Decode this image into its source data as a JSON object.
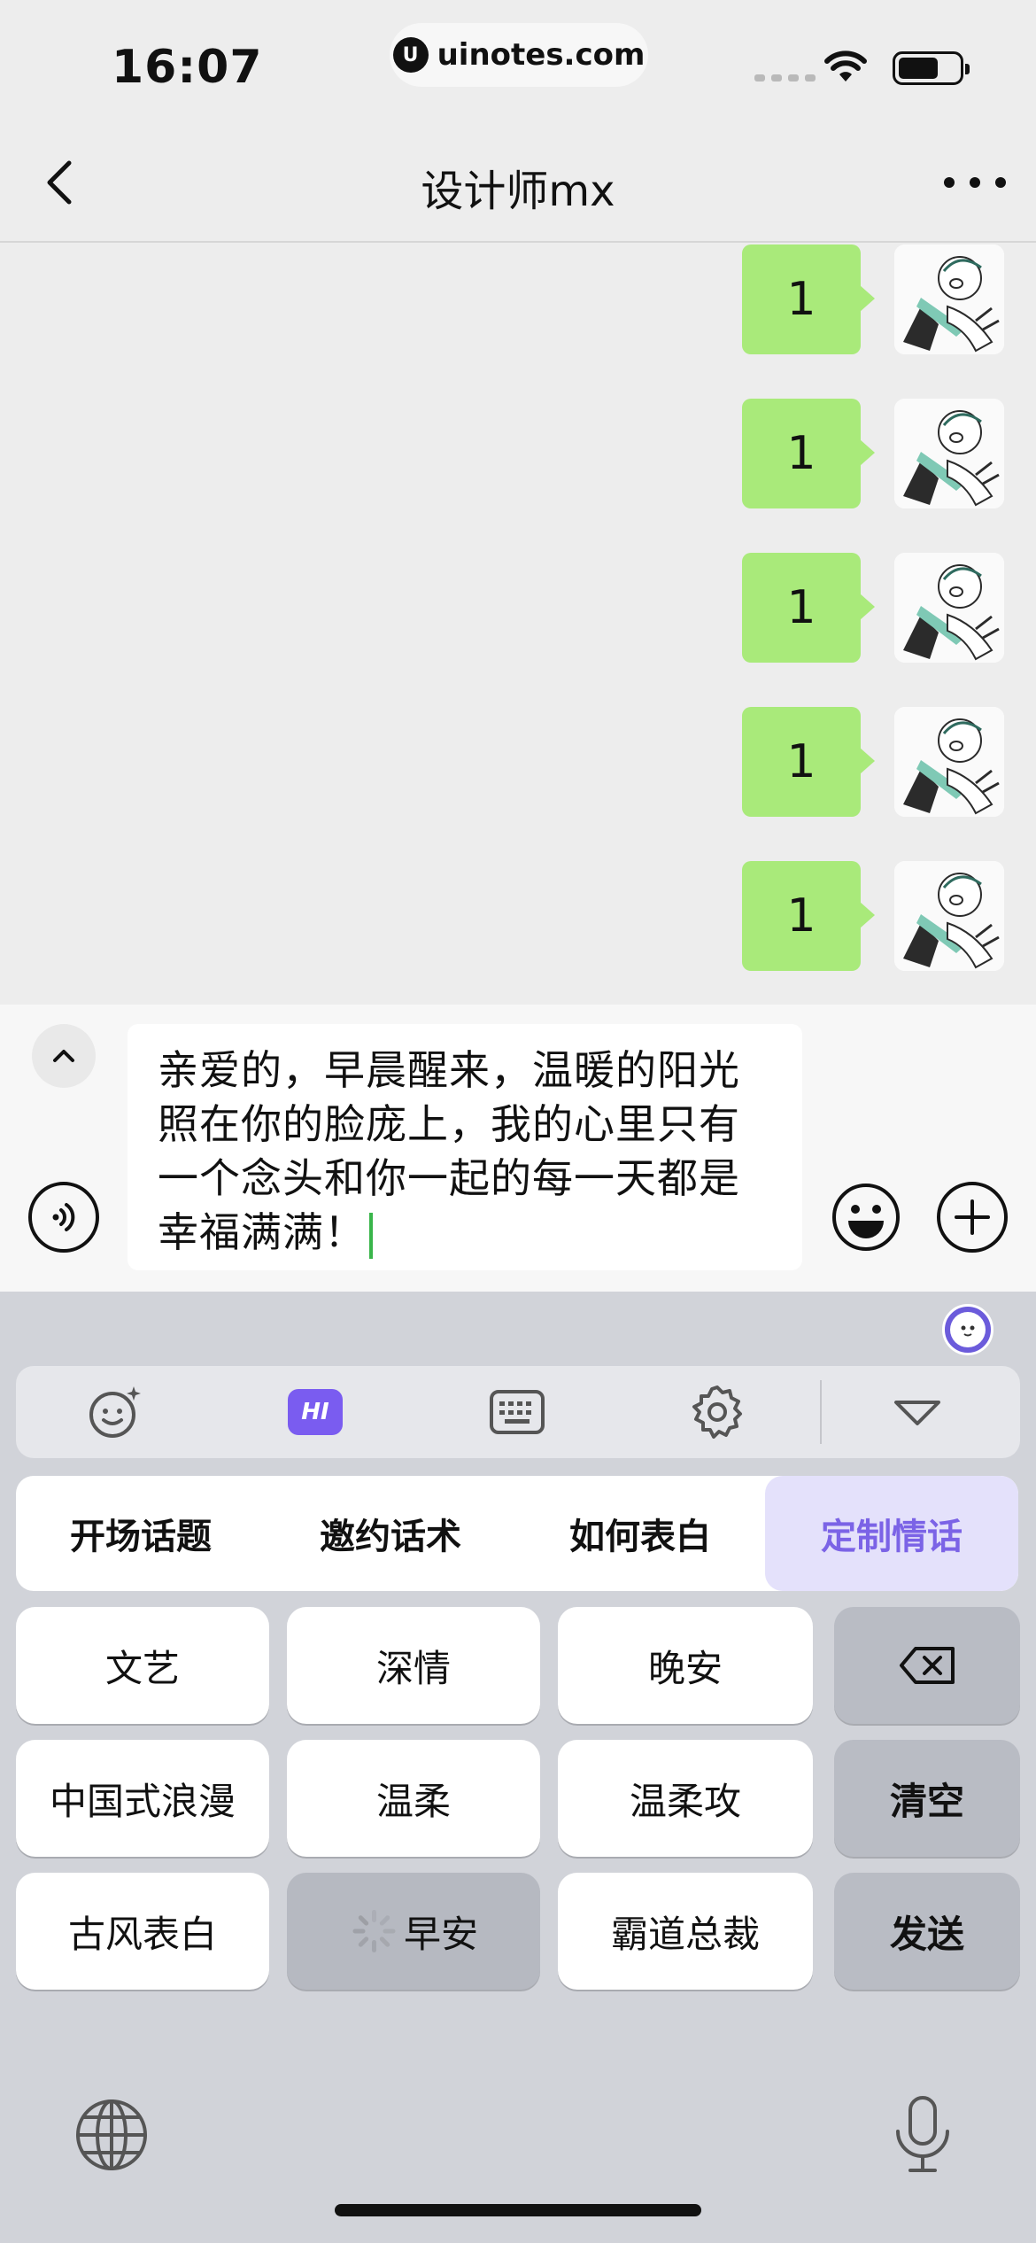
{
  "status_bar": {
    "time": "16:07",
    "url": "uinotes.com",
    "url_logo": "U"
  },
  "nav": {
    "title": "设计师mx",
    "back_icon": "chevron-left-icon",
    "more_icon": "ellipsis-icon"
  },
  "messages": [
    {
      "text": "1",
      "sender": "self"
    },
    {
      "text": "1",
      "sender": "self"
    },
    {
      "text": "1",
      "sender": "self"
    },
    {
      "text": "1",
      "sender": "self"
    },
    {
      "text": "1",
      "sender": "self"
    }
  ],
  "input": {
    "text": "亲爱的，早晨醒来，温暖的阳光照在你的脸庞上，我的心里只有一个念头和你一起的每一天都是幸福满满！"
  },
  "keyboard": {
    "toolbar": [
      "emoji-icon",
      "hi-icon",
      "keyboard-icon",
      "settings-icon",
      "collapse-icon"
    ],
    "hi_label": "HI",
    "tabs": [
      "开场话题",
      "邀约话术",
      "如何表白",
      "定制情话"
    ],
    "active_tab": "定制情话",
    "keys": {
      "row1": [
        "文艺",
        "深情",
        "晚安"
      ],
      "row2": [
        "中国式浪漫",
        "温柔",
        "温柔攻"
      ],
      "row3": [
        "古风表白",
        "早安",
        "霸道总裁"
      ],
      "clear": "清空",
      "send": "发送"
    },
    "delete_icon": "backspace-icon",
    "globe_icon": "globe-icon",
    "mic_icon": "microphone-icon"
  },
  "colors": {
    "bubble": "#a9ea7a",
    "accent": "#7b63e6",
    "caret": "#39b54a"
  }
}
